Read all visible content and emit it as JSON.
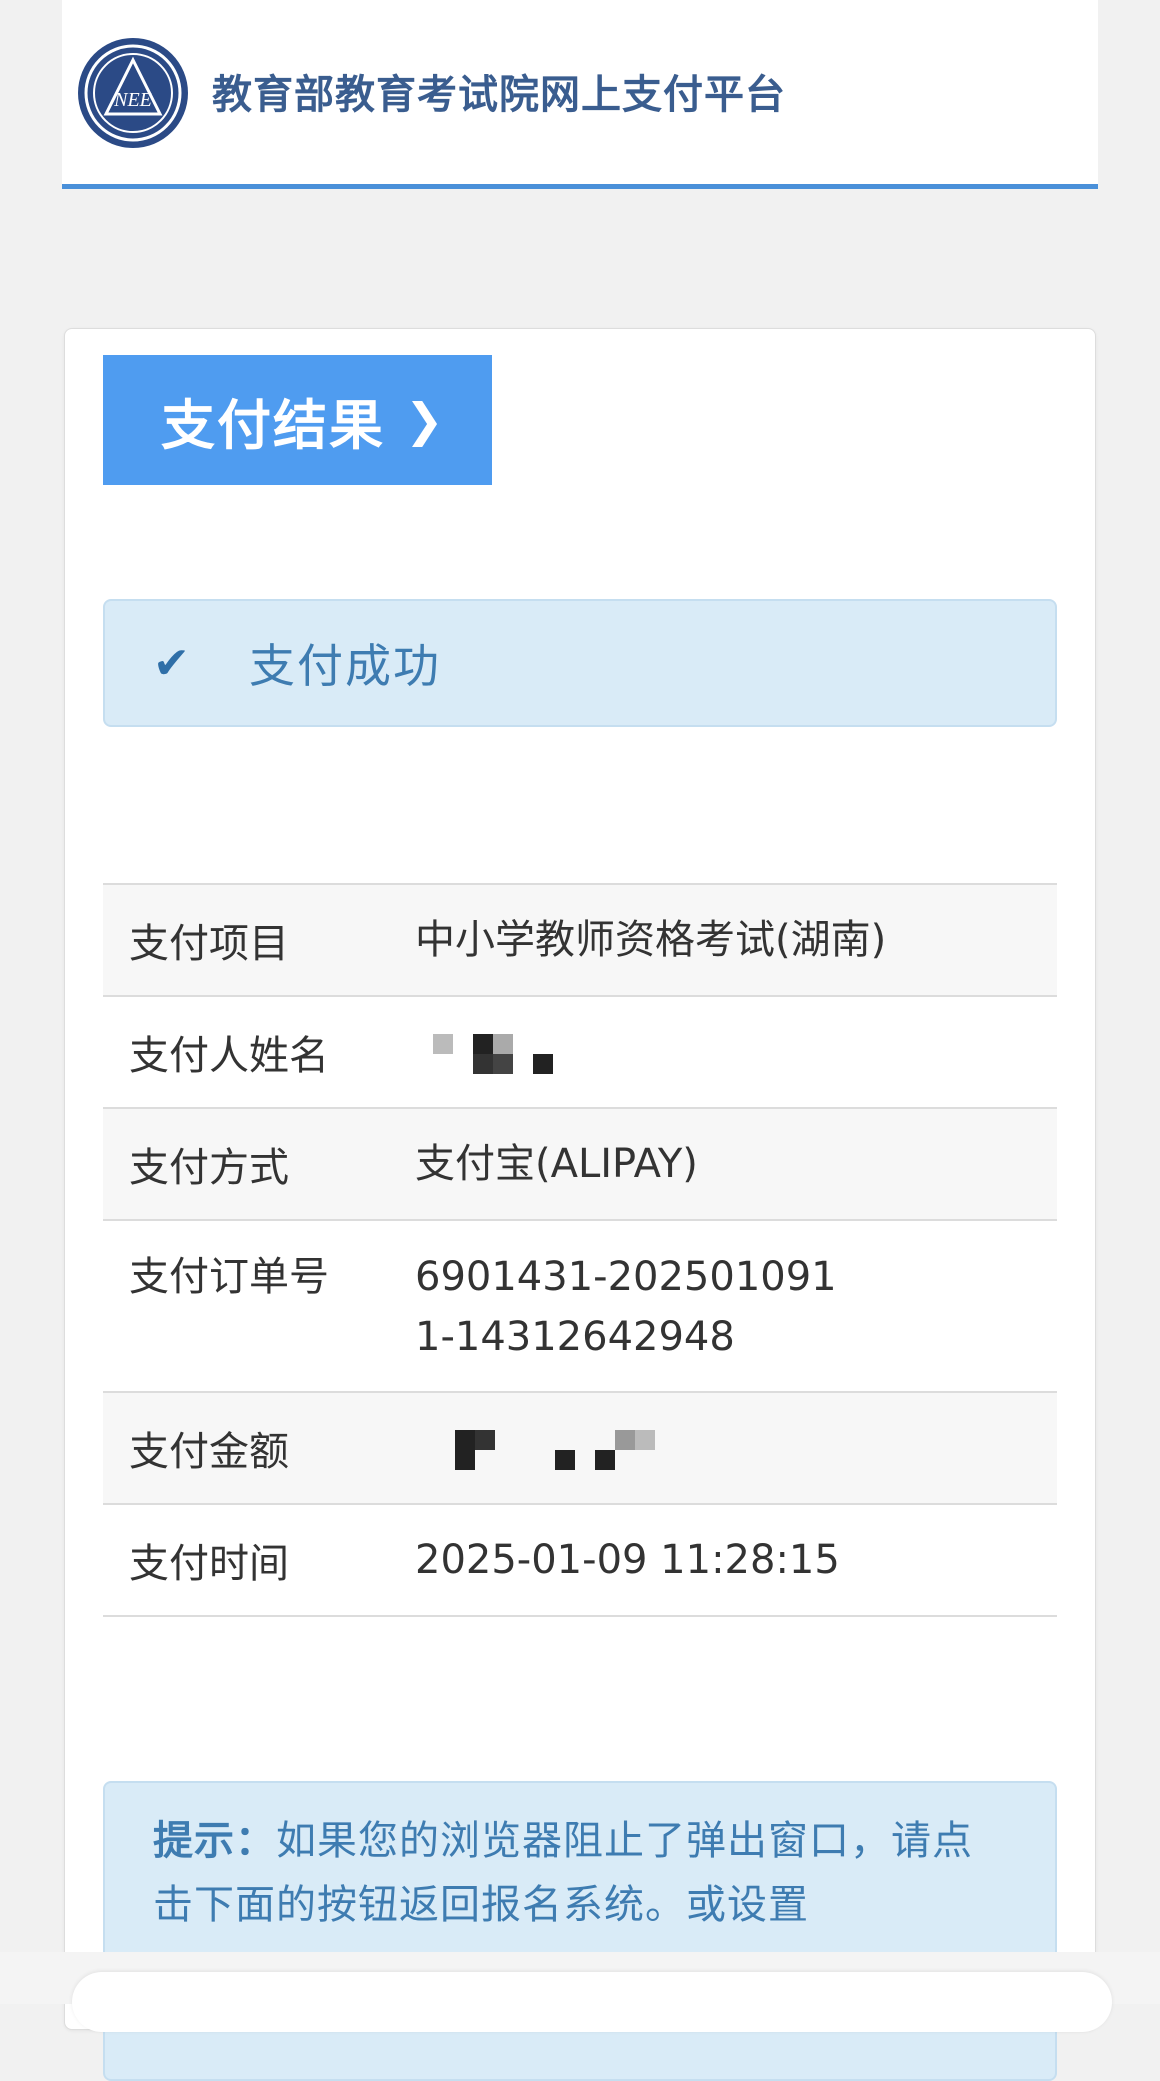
{
  "header": {
    "site_title": "教育部教育考试院网上支付平台",
    "logo_text": "NEE"
  },
  "result_button": {
    "label": "支付结果"
  },
  "status": {
    "message": "支付成功"
  },
  "details": {
    "rows": [
      {
        "label": "支付项目",
        "value": "中小学教师资格考试(湖南)"
      },
      {
        "label": "支付人姓名",
        "value": ""
      },
      {
        "label": "支付方式",
        "value": "支付宝(ALIPAY)"
      },
      {
        "label": "支付订单号",
        "value": "6901431-2025010911-14312642948"
      },
      {
        "label": "支付金额",
        "value": ""
      },
      {
        "label": "支付时间",
        "value": "2025-01-09 11:28:15"
      }
    ]
  },
  "tip": {
    "label": "提示：",
    "text": "如果您的浏览器阻止了弹出窗口，请点击下面的按钮返回报名系统。或设置"
  },
  "colors": {
    "accent": "#4f9cf0",
    "header_border": "#4a90d9",
    "title": "#3a5d8f",
    "alert_bg": "#d9ebf7",
    "alert_text": "#3e7cb1"
  }
}
